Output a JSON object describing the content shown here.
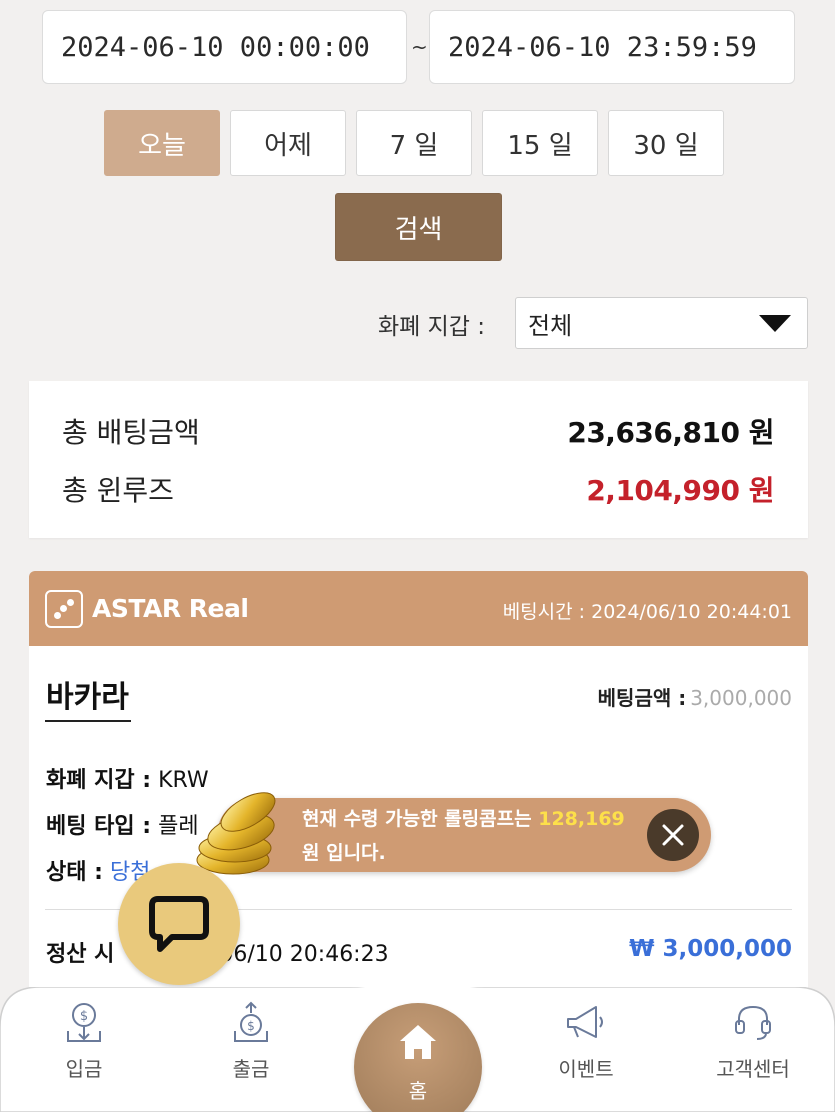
{
  "date_range": {
    "start": "2024-06-10 00:00:00",
    "separator": "~",
    "end": "2024-06-10 23:59:59"
  },
  "quick_ranges": [
    "오늘",
    "어제",
    "7 일",
    "15 일",
    "30 일"
  ],
  "active_range_index": 0,
  "search_label": "검색",
  "wallet": {
    "label": "화폐 지갑 :",
    "selected": "전체"
  },
  "summary": {
    "total_bet_label": "총 배팅금액",
    "total_bet_value": "23,636,810 원",
    "total_winloss_label": "총 윈루즈",
    "total_winloss_value": "2,104,990 원"
  },
  "bet_card": {
    "provider": "ASTAR Real",
    "bet_time_label": "베팅시간 :",
    "bet_time": "2024/06/10 20:44:01",
    "game": "바카라",
    "bet_amount_label": "베팅금액 :",
    "bet_amount": "3,000,000",
    "currency_label": "화폐 지갑 :",
    "currency_value": "KRW",
    "bet_type_label": "베팅 타입 :",
    "bet_type_value": "플레",
    "status_label": "상태 :",
    "status_value": "당첨",
    "settle_label": "정산 시",
    "settle_time": "06/10 20:46:23",
    "settle_amount": "₩ 3,000,000"
  },
  "toast": {
    "text_before": "현재 수령 가능한 롤링콤프는 ",
    "amount": "128,169",
    "text_after": "원 입니다."
  },
  "nav": {
    "deposit": "입금",
    "withdraw": "출금",
    "home": "홈",
    "event": "이벤트",
    "support": "고객센터"
  },
  "colors": {
    "accent": "#cf9b73",
    "search_button": "#8a6b4e",
    "loss_red": "#c4212b",
    "link_blue": "#3a6fd8"
  }
}
